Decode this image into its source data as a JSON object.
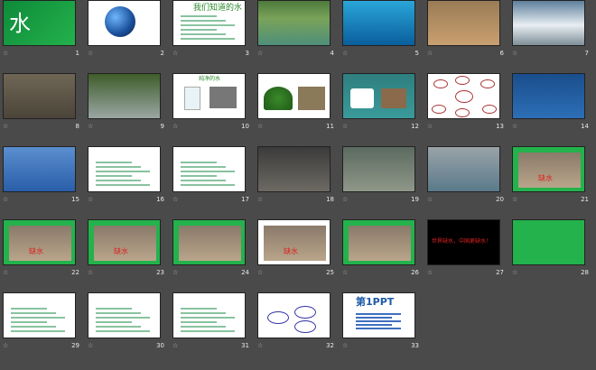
{
  "slides": [
    {
      "n": "1",
      "title": "水",
      "sub": "",
      "kind": "title"
    },
    {
      "n": "2",
      "title": "",
      "sub": "",
      "kind": "earth"
    },
    {
      "n": "3",
      "title": "我们知道的水",
      "sub": "",
      "kind": "list"
    },
    {
      "n": "4",
      "title": "",
      "sub": "",
      "kind": "river"
    },
    {
      "n": "5",
      "title": "",
      "sub": "",
      "kind": "sea"
    },
    {
      "n": "6",
      "title": "",
      "sub": "",
      "kind": "flood"
    },
    {
      "n": "7",
      "title": "",
      "sub": "",
      "kind": "falls"
    },
    {
      "n": "8",
      "title": "",
      "sub": "",
      "kind": "mud"
    },
    {
      "n": "9",
      "title": "",
      "sub": "",
      "kind": "pollute"
    },
    {
      "n": "10",
      "title": "纯净的水",
      "sub": "",
      "kind": "glass"
    },
    {
      "n": "11",
      "title": "",
      "sub": "",
      "kind": "tree"
    },
    {
      "n": "12",
      "title": "",
      "sub": "",
      "kind": "food"
    },
    {
      "n": "13",
      "title": "",
      "sub": "",
      "kind": "mind"
    },
    {
      "n": "14",
      "title": "",
      "sub": "",
      "kind": "blue"
    },
    {
      "n": "15",
      "title": "",
      "sub": "",
      "kind": "blue2"
    },
    {
      "n": "16",
      "title": "",
      "sub": "",
      "kind": "table"
    },
    {
      "n": "17",
      "title": "",
      "sub": "",
      "kind": "text"
    },
    {
      "n": "18",
      "title": "",
      "sub": "",
      "kind": "child"
    },
    {
      "n": "19",
      "title": "",
      "sub": "",
      "kind": "river2"
    },
    {
      "n": "20",
      "title": "",
      "sub": "",
      "kind": "fish"
    },
    {
      "n": "21",
      "title": "缺水",
      "sub": "",
      "kind": "green1"
    },
    {
      "n": "22",
      "title": "缺水",
      "sub": "",
      "kind": "green2"
    },
    {
      "n": "23",
      "title": "缺水",
      "sub": "",
      "kind": "green3"
    },
    {
      "n": "24",
      "title": "",
      "sub": "",
      "kind": "green4"
    },
    {
      "n": "25",
      "title": "缺水",
      "sub": "",
      "kind": "green5"
    },
    {
      "n": "26",
      "title": "",
      "sub": "",
      "kind": "green6"
    },
    {
      "n": "27",
      "title": "世界缺水，中国更缺水！",
      "sub": "",
      "kind": "black"
    },
    {
      "n": "28",
      "title": "",
      "sub": "",
      "kind": "green7"
    },
    {
      "n": "29",
      "title": "",
      "sub": "",
      "kind": "doc"
    },
    {
      "n": "30",
      "title": "",
      "sub": "",
      "kind": "doc"
    },
    {
      "n": "31",
      "title": "",
      "sub": "",
      "kind": "doc"
    },
    {
      "n": "32",
      "title": "",
      "sub": "",
      "kind": "diag"
    },
    {
      "n": "33",
      "title": "第1PPT",
      "sub": "",
      "kind": "ppt"
    }
  ]
}
